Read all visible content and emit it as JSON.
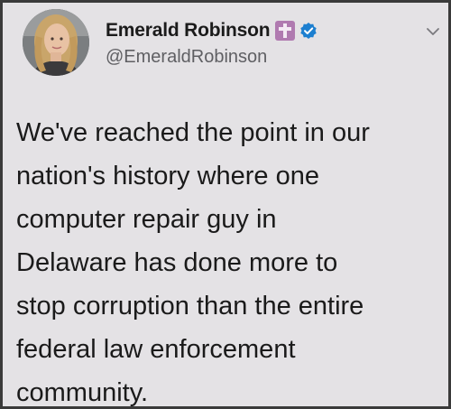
{
  "tweet": {
    "author": {
      "display_name": "Emerald Robinson",
      "handle": "@EmeraldRobinson",
      "badges": [
        "cross-icon",
        "verified-icon"
      ]
    },
    "text_lines": [
      "We've reached the point in our",
      "nation's history where one",
      "computer repair guy in",
      "Delaware has done more to",
      "stop corruption than the entire",
      "federal law enforcement",
      "community."
    ],
    "menu_icon": "chevron-down-icon"
  },
  "colors": {
    "card_background": "#e4e2e5",
    "text": "#1a1a1a",
    "handle": "#5f5f63",
    "verified_blue": "#1d7fd0",
    "cross_badge": "#b07ab0"
  }
}
